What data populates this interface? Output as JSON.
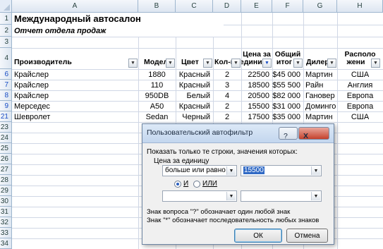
{
  "sheet": {
    "columns": [
      "A",
      "B",
      "C",
      "D",
      "E",
      "F",
      "G",
      "H"
    ],
    "row_numbers": [
      "1",
      "2",
      "3",
      "4",
      "6",
      "7",
      "8",
      "9",
      "21",
      "23",
      "24",
      "25",
      "26",
      "27",
      "28",
      "29",
      "30",
      "31",
      "32",
      "33",
      "34"
    ],
    "title": "Международный автосалон",
    "subtitle": "Отчет отдела продаж",
    "headers": {
      "a": "Производитель",
      "b": "Модель",
      "c": "Цвет",
      "d": "Кол-во",
      "e1": "Цена за",
      "e2": "единиц",
      "f1": "Общий",
      "f2": "итог",
      "g": "Дилер",
      "h1": "Располо",
      "h2": "жени"
    },
    "rows": [
      {
        "a": "Крайслер",
        "b": "1880",
        "c": "Красный",
        "d": "2",
        "e": "22500",
        "f": "$45 000",
        "g": "Мартин",
        "h": "США"
      },
      {
        "a": "Крайслер",
        "b": "110",
        "c": "Красный",
        "d": "3",
        "e": "18500",
        "f": "$55 500",
        "g": "Райн",
        "h": "Англия"
      },
      {
        "a": "Крайслер",
        "b": "950DB",
        "c": "Белый",
        "d": "4",
        "e": "20500",
        "f": "$82 000",
        "g": "Гановер",
        "h": "Европа"
      },
      {
        "a": "Мерседес",
        "b": "A50",
        "c": "Красный",
        "d": "2",
        "e": "15500",
        "f": "$31 000",
        "g": "Доминго",
        "h": "Европа"
      },
      {
        "a": "Шевролет",
        "b": "Sedan",
        "c": "Черный",
        "d": "2",
        "e": "17500",
        "f": "$35 000",
        "g": "Мартин",
        "h": "США"
      }
    ]
  },
  "dialog": {
    "title": "Пользовательский автофильтр",
    "help_label": "?",
    "close_label": "X",
    "instruction": "Показать только те строки, значения которых:",
    "field_label": "Цена за единицу",
    "operator1": "больше или равно",
    "value1": "15500",
    "radio_and": "И",
    "radio_or": "ИЛИ",
    "operator2": "",
    "value2": "",
    "hint1": "Знак вопроса \"?\" обозначает один любой знак",
    "hint2": "Знак \"*\" обозначает последовательность любых знаков",
    "ok_label": "ОК",
    "cancel_label": "Отмена"
  }
}
